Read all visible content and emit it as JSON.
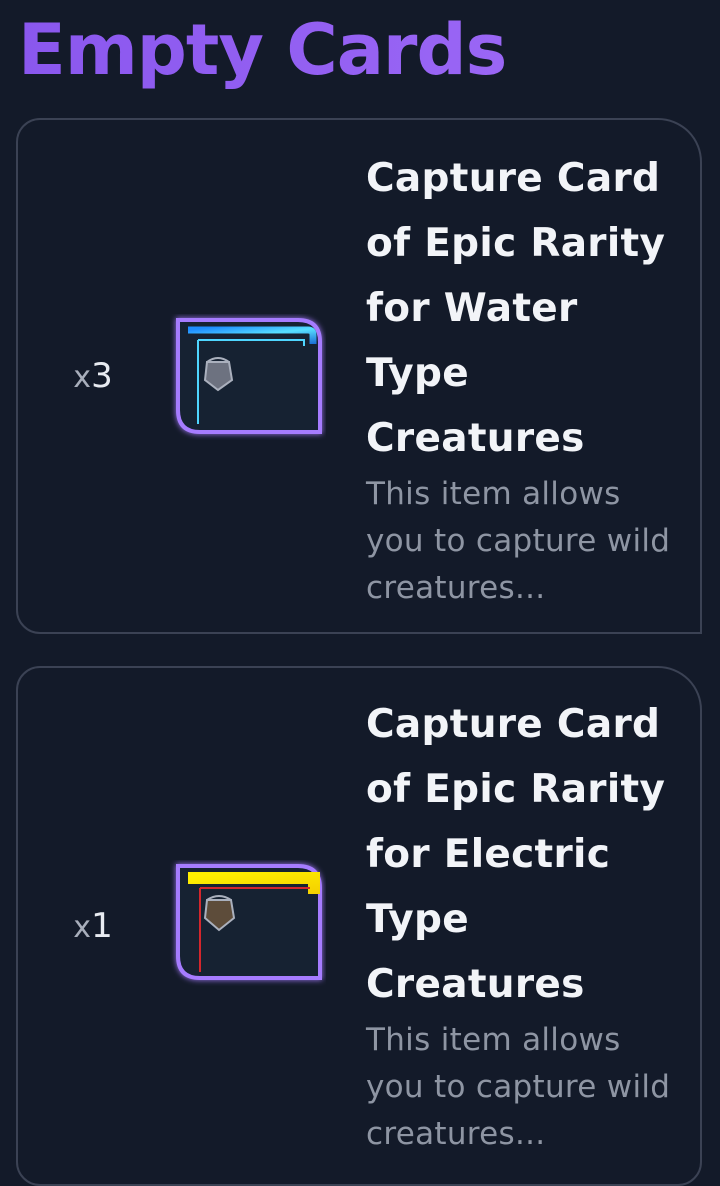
{
  "page": {
    "title": "Empty Cards"
  },
  "cards": [
    {
      "quantity_prefix": "x",
      "quantity_value": "3",
      "title": "Capture Card of Epic Rarity for Water Type Creatures",
      "description": "This item allows you to capture wild creatures...",
      "icon": "water-capture-card-icon",
      "frame_color": "#2ab7ff",
      "glow_color": "#8b5cf6"
    },
    {
      "quantity_prefix": "x",
      "quantity_value": "1",
      "title": "Capture Card of Epic Rarity for Electric Type Creatures",
      "description": "This item allows you to capture wild creatures...",
      "icon": "electric-capture-card-icon",
      "frame_color": "#ffe400",
      "glow_color": "#8b5cf6"
    }
  ],
  "colors": {
    "accent": "#8b5cf6",
    "background": "#131a29",
    "card_border": "#3b4254",
    "title_text": "#f2f4f8",
    "muted_text": "#8e95a3"
  }
}
